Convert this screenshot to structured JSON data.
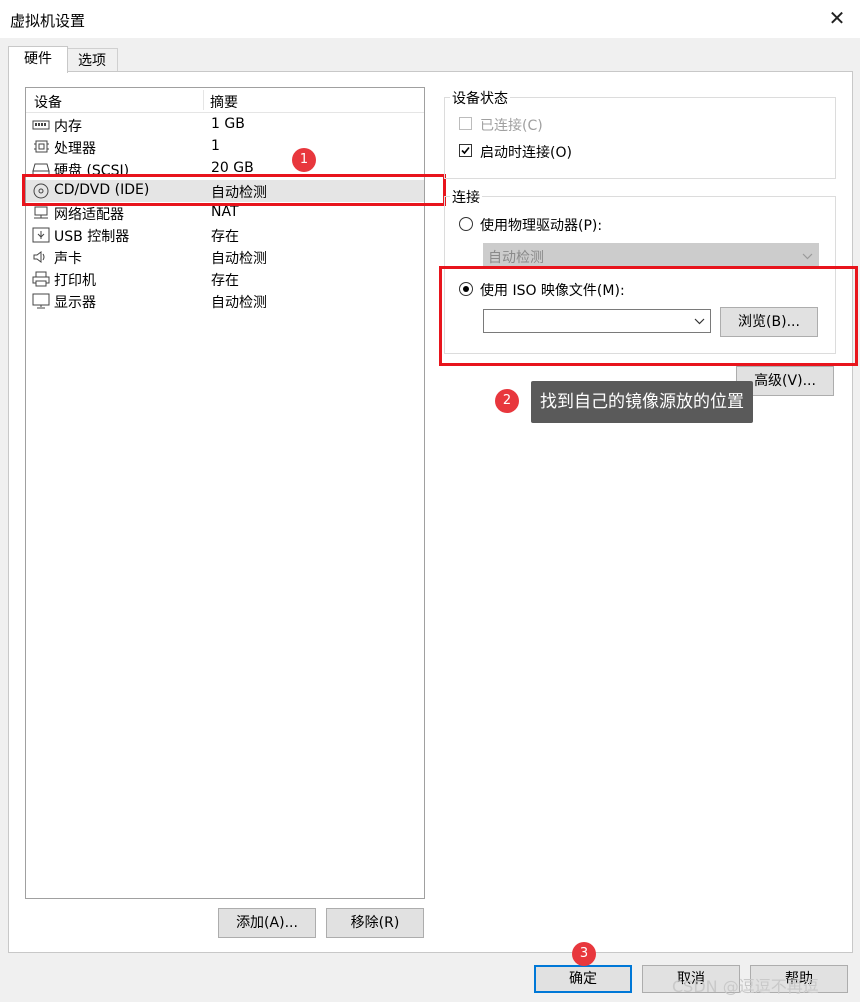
{
  "window": {
    "title": "虚拟机设置",
    "close_glyph": "✕"
  },
  "tabs": [
    {
      "label": "硬件"
    },
    {
      "label": "选项"
    }
  ],
  "device_list": {
    "col_device": "设备",
    "col_summary": "摘要",
    "rows": [
      {
        "name": "内存",
        "summary": "1 GB",
        "icon": "memory-icon"
      },
      {
        "name": "处理器",
        "summary": "1",
        "icon": "processor-icon"
      },
      {
        "name": "硬盘 (SCSI)",
        "summary": "20 GB",
        "icon": "hard-disk-icon"
      },
      {
        "name": "CD/DVD (IDE)",
        "summary": "自动检测",
        "icon": "cd-dvd-icon",
        "selected": true
      },
      {
        "name": "网络适配器",
        "summary": "NAT",
        "icon": "network-adapter-icon"
      },
      {
        "name": "USB 控制器",
        "summary": "存在",
        "icon": "usb-icon"
      },
      {
        "name": "声卡",
        "summary": "自动检测",
        "icon": "speaker-icon"
      },
      {
        "name": "打印机",
        "summary": "存在",
        "icon": "printer-icon"
      },
      {
        "name": "显示器",
        "summary": "自动检测",
        "icon": "monitor-icon"
      }
    ]
  },
  "list_buttons": {
    "add": "添加(A)...",
    "remove": "移除(R)"
  },
  "device_status": {
    "group_label": "设备状态",
    "connected": {
      "label": "已连接(C)",
      "checked": false,
      "disabled": true
    },
    "connect_at_power_on": {
      "label": "启动时连接(O)",
      "checked": true
    }
  },
  "connection": {
    "group_label": "连接",
    "physical": {
      "label": "使用物理驱动器(P):",
      "selected": false
    },
    "physical_drive_value": "自动检测",
    "iso": {
      "label": "使用 ISO 映像文件(M):",
      "selected": true
    },
    "iso_path_value": "",
    "browse": "浏览(B)...",
    "advanced": "高级(V)..."
  },
  "annotations": {
    "badge1": "1",
    "badge2": "2",
    "badge3": "3",
    "tooltip": "找到自己的镜像源放的位置"
  },
  "footer": {
    "ok": "确定",
    "cancel": "取消",
    "help": "帮助"
  },
  "watermark": "CSDN @逗逗不再逗",
  "colors": {
    "highlight_red": "#e8141c",
    "badge_red": "#e8373d",
    "focus_blue": "#0078d7",
    "tooltip_bg": "#5a5a5a"
  }
}
